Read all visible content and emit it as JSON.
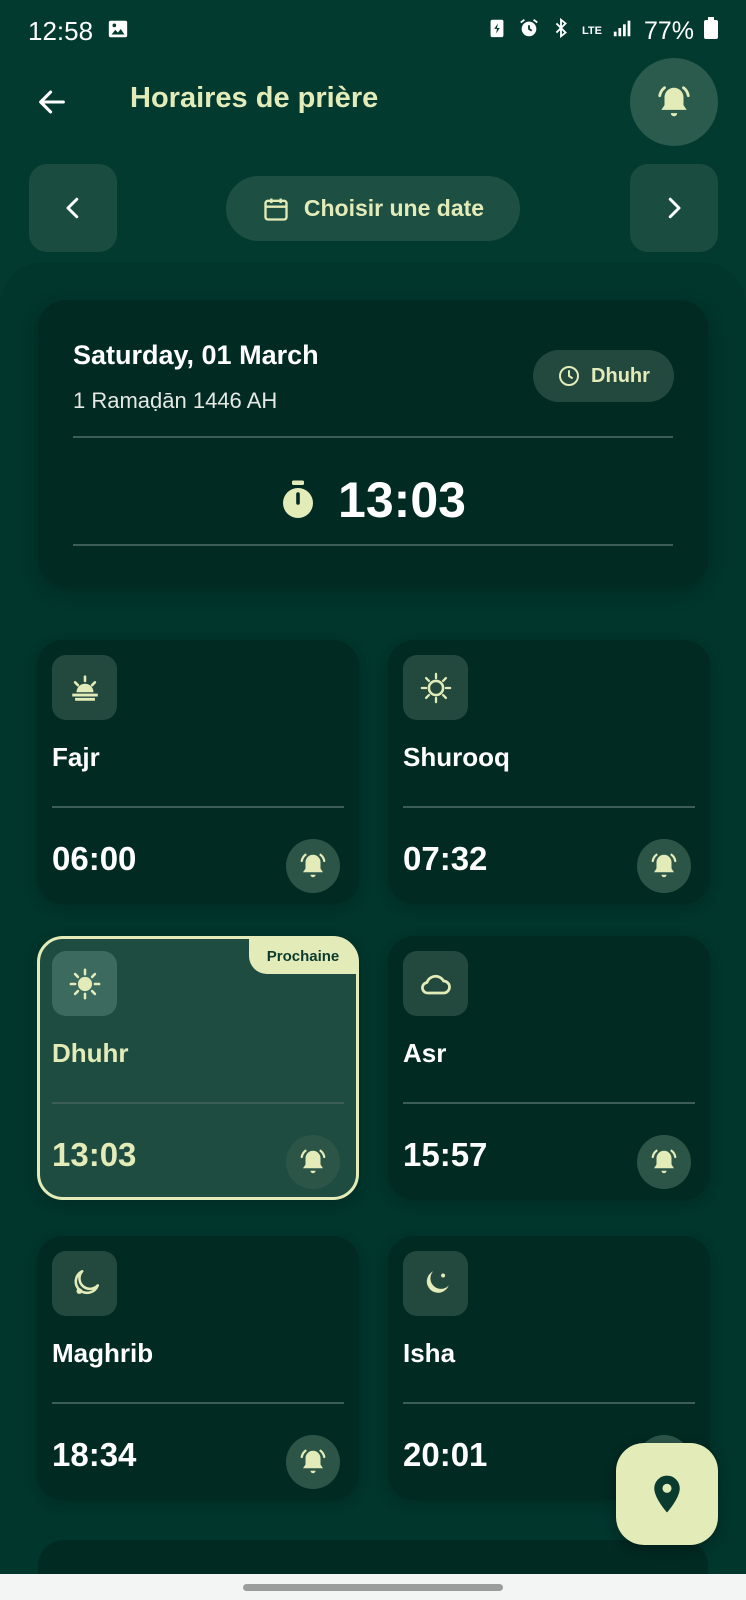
{
  "status_bar": {
    "time": "12:58",
    "network": "LTE",
    "battery": "77%"
  },
  "app_bar": {
    "title": "Horaires de prière"
  },
  "date_nav": {
    "choose_date_label": "Choisir une date"
  },
  "date_card": {
    "gregorian_date": "Saturday, 01 March",
    "hijri_date": "1 Ramaḍān 1446 AH",
    "next_prayer_chip": "Dhuhr",
    "countdown": "13:03"
  },
  "prayers": [
    {
      "name": "Fajr",
      "time": "06:00",
      "icon": "sunrise-icon"
    },
    {
      "name": "Shurooq",
      "time": "07:32",
      "icon": "sun-outline-icon"
    },
    {
      "name": "Dhuhr",
      "time": "13:03",
      "icon": "sun-icon",
      "badge": "Prochaine"
    },
    {
      "name": "Asr",
      "time": "15:57",
      "icon": "cloud-icon"
    },
    {
      "name": "Maghrib",
      "time": "18:34",
      "icon": "crescent-outline-icon"
    },
    {
      "name": "Isha",
      "time": "20:01",
      "icon": "crescent-icon"
    }
  ],
  "colors": {
    "background": "#023a30",
    "card": "#012a22",
    "accent": "#e3ecb9",
    "next_card": "#1f4c40"
  }
}
